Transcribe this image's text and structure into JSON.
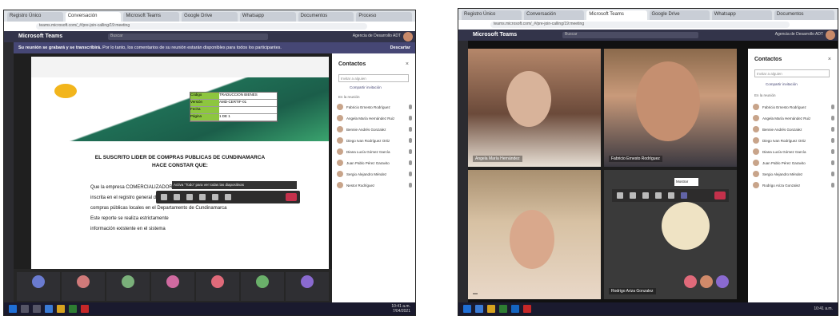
{
  "left": {
    "browser_tabs": [
      "Registro Único",
      "Conversación",
      "Microsoft Teams",
      "Google Drive",
      "Whatsapp",
      "Documentos",
      "Proceso"
    ],
    "url": "teams.microsoft.com/_#/pre-join-calling/19:meeting",
    "app_title": "Microsoft Teams",
    "search_placeholder": "Buscar",
    "user_name": "Agencia de Desarrollo ADT",
    "banner_bold": "Su reunión se grabará y se transcribirá.",
    "banner_text": "Por lo tanto, los comentarios de su reunión estarán disponibles para todos los participantes.",
    "banner_action": "Descartar",
    "doc": {
      "logo_text": "Agencia",
      "table_rows": [
        {
          "k": "Código",
          "v": "TRADUCCION BIENES"
        },
        {
          "k": "Versión",
          "v": "AMD-CERTIF-01"
        },
        {
          "k": "Fecha",
          "v": ""
        },
        {
          "k": "Página",
          "v": "1 DE 1"
        }
      ],
      "heading_line1": "EL SUSCRITO LIDER DE COMPRAS PUBLICAS DE CUNDINAMARCA",
      "heading_line2": "HACE CONSTAR QUE:",
      "body_lines": [
        "Que la empresa COMERCIALIZADORA H G A.S., NIT. 900.740.715-1, se encuentra",
        "inscrita en el registro general de proveedores",
        "compras públicas locales en el Departamento de Cundinamarca",
        "Este reporte se realiza estrictamente",
        "información existente en el sistema"
      ],
      "tooltip": "Activa “Todo” para ver todas las diapositivas"
    },
    "panel": {
      "title": "Contactos",
      "close": "×",
      "input_placeholder": "Invitar a alguien",
      "share_link": "Compartir invitación",
      "section_label": "En la reunión",
      "participants": [
        "Fabricio Ernesto Rodríguez",
        "Angela María Hernández Ruiz",
        "Bennie Andrés Gonzalez",
        "Diego Ivan Rodríguez Ortiz",
        "Diana Lucía Gómez García",
        "Juan Pablo Pérez Garavito",
        "Sergio Alejandro Méndez",
        "Nestor Rodríguez"
      ]
    },
    "taskbar_time": "10:41 a.m.",
    "taskbar_date": "7/04/2021"
  },
  "right": {
    "browser_tabs": [
      "Registro Único",
      "Conversación",
      "Microsoft Teams",
      "Google Drive",
      "Whatsapp",
      "Documentos"
    ],
    "url": "teams.microsoft.com/_#/pre-join-calling/19:meeting",
    "app_title": "Microsoft Teams",
    "search_placeholder": "Buscar",
    "user_name": "Agencia de Desarrollo ADT",
    "tile_names": [
      "Angela María Hernández",
      "Fabricio Ernesto Rodríguez",
      "",
      "Rodrigo Ariza Gonzalez"
    ],
    "tooltip": "Mostrar",
    "panel": {
      "title": "Contactos",
      "close": "×",
      "input_placeholder": "Invitar a alguien",
      "share_link": "Compartir invitación",
      "section_label": "En la reunión",
      "participants": [
        "Fabricio Ernesto Rodríguez",
        "Angela María Hernández Ruiz",
        "Bennie Andrés Gonzalez",
        "Diego Ivan Rodríguez Ortiz",
        "Diana Lucía Gómez García",
        "Juan Pablo Pérez Garavito",
        "Sergio Alejandro Méndez",
        "Rodrigo Ariza Gonzalez"
      ]
    },
    "taskbar_time": "10:41 a.m."
  },
  "colors": {
    "teams_purple": "#464775",
    "green": "#1f6e55",
    "hangup": "#c4314b"
  },
  "icons": [
    "search-icon",
    "mic-icon",
    "camera-icon",
    "share-icon",
    "hangup-icon",
    "close-icon"
  ]
}
